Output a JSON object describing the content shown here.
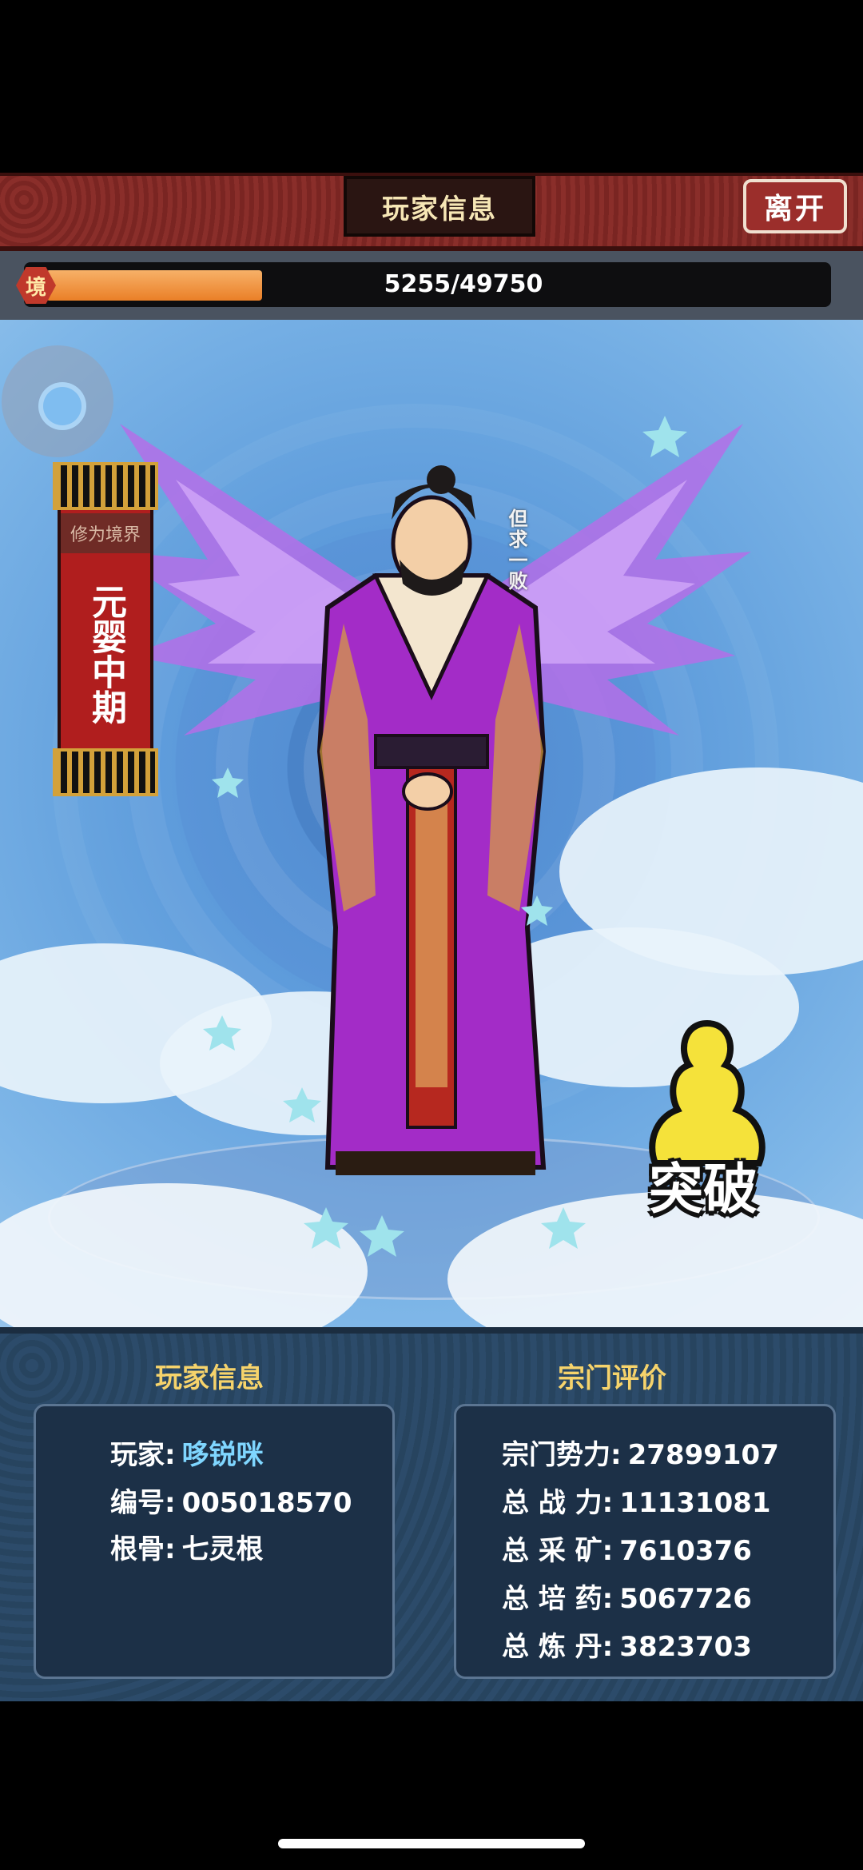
{
  "header": {
    "title": "玩家信息",
    "leave_label": "离开"
  },
  "progress": {
    "badge": "境",
    "current": 5255,
    "max": 49750,
    "text": "5255/49750",
    "fill_fraction": 0.106
  },
  "realm": {
    "caption": "修为境界",
    "stage": "元婴中期"
  },
  "character": {
    "motto": "但求一败"
  },
  "breakthrough": {
    "label": "突破"
  },
  "player_info": {
    "title": "玩家信息",
    "rows": [
      {
        "label": "玩家:",
        "value": "哆锐咪"
      },
      {
        "label": "编号:",
        "value": "005018570"
      },
      {
        "label": "根骨:",
        "value": "七灵根"
      }
    ]
  },
  "sect_eval": {
    "title": "宗门评价",
    "rows": [
      {
        "label": "宗门势力:",
        "value": "27899107"
      },
      {
        "label": "总 战 力:",
        "value": "11131081"
      },
      {
        "label": "总 采 矿:",
        "value": "7610376"
      },
      {
        "label": "总 培 药:",
        "value": "5067726"
      },
      {
        "label": "总 炼 丹:",
        "value": "3823703"
      }
    ]
  },
  "colors": {
    "accent": "#f6d36b",
    "header_red": "#8a2e2a",
    "progress_orange": "#ea7f27",
    "value_blue": "#7fd6ff"
  }
}
